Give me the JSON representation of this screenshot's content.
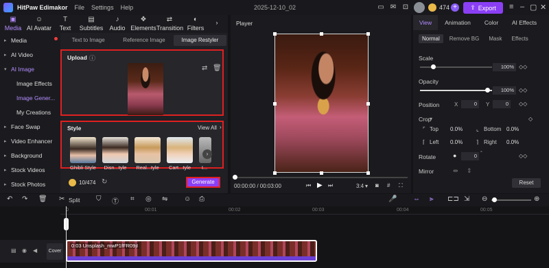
{
  "app": {
    "name": "HitPaw Edimakor",
    "project": "2025-12-10_02",
    "coins": "474",
    "export_label": "Export"
  },
  "menu": [
    "File",
    "Settings",
    "Help"
  ],
  "top_tabs": [
    {
      "label": "Media",
      "icon": "media-icon"
    },
    {
      "label": "AI Avatar",
      "icon": "avatar-icon"
    },
    {
      "label": "Text",
      "icon": "text-icon"
    },
    {
      "label": "Subtitles",
      "icon": "subtitles-icon"
    },
    {
      "label": "Audio",
      "icon": "audio-icon"
    },
    {
      "label": "Elements",
      "icon": "elements-icon"
    },
    {
      "label": "Transition",
      "icon": "transition-icon"
    },
    {
      "label": "Filters",
      "icon": "filters-icon"
    }
  ],
  "sidebar": {
    "items": [
      {
        "label": "Media"
      },
      {
        "label": "AI Video"
      },
      {
        "label": "AI Image"
      },
      {
        "label": "Image Effects"
      },
      {
        "label": "Image Gener..."
      },
      {
        "label": "My Creations"
      },
      {
        "label": "Face Swap"
      },
      {
        "label": "Video Enhancer"
      },
      {
        "label": "Background"
      },
      {
        "label": "Stock Videos"
      },
      {
        "label": "Stock Photos"
      }
    ]
  },
  "center": {
    "tabs": [
      "Text to Image",
      "Reference Image",
      "Image Restyler"
    ],
    "upload_label": "Upload",
    "style_label": "Style",
    "view_all": "View All",
    "styles": [
      "Ghibli Style",
      "Disn...tyle",
      "Real...tyle",
      "Cart...tyle",
      "I..."
    ],
    "credits": "10/474",
    "generate_label": "Generate"
  },
  "player": {
    "header": "Player",
    "time": "00:00:00 / 00:03:00",
    "ratio": "3:4"
  },
  "right": {
    "tabs": [
      "View",
      "Animation",
      "Color",
      "AI Effects"
    ],
    "subtabs": [
      "Normal",
      "Remove BG",
      "Mask",
      "Effects"
    ],
    "scale_label": "Scale",
    "scale_value": "100%",
    "scale_level": 1.0,
    "opacity_label": "Opacity",
    "opacity_value": "100%",
    "opacity_level": 1.0,
    "position_label": "Position",
    "pos_x_label": "X",
    "pos_x": "0",
    "pos_y_label": "Y",
    "pos_y": "0",
    "crop_label": "Crop",
    "crop_top_label": "Top",
    "crop_top": "0.0%",
    "crop_bottom_label": "Bottom",
    "crop_bottom": "0.0%",
    "crop_left_label": "Left",
    "crop_left": "0.0%",
    "crop_right_label": "Right",
    "crop_right": "0.0%",
    "rotate_label": "Rotate",
    "rotate_value": "0",
    "mirror_label": "Mirror",
    "reset_label": "Reset"
  },
  "toolbar": {
    "split_label": "Split"
  },
  "timeline": {
    "ruler": [
      "0",
      "00:01",
      "00:02",
      "00:03",
      "00:04",
      "00:05"
    ],
    "cover_label": "Cover",
    "clip_label": "0:03 Unsplash_mwP1fFR09jI"
  }
}
